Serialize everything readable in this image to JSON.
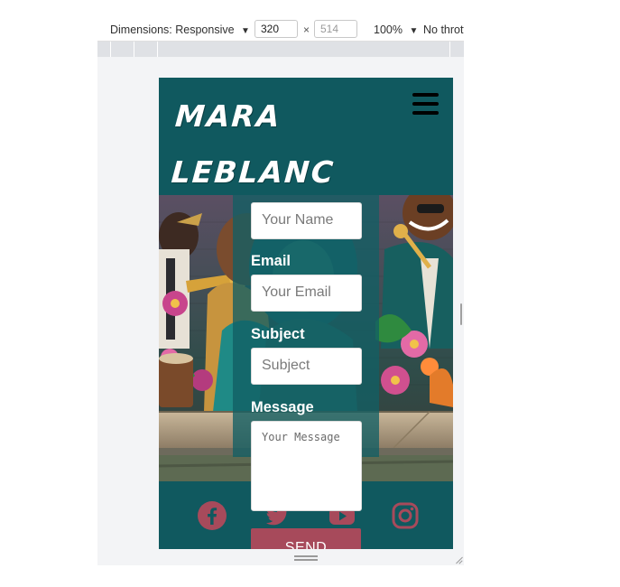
{
  "devtools": {
    "dimensions_label": "Dimensions: Responsive",
    "width_value": "320",
    "height_value": "514",
    "times_sign": "×",
    "zoom": "100%",
    "throttle": "No throttling",
    "caret": "▼"
  },
  "site": {
    "logo_line1": "MARA",
    "logo_line2": "LEBLANC",
    "menu_icon": "hamburger-menu-icon"
  },
  "form": {
    "name_placeholder": "Your Name",
    "email_label": "Email",
    "email_placeholder": "Your Email",
    "subject_label": "Subject",
    "subject_placeholder": "Subject",
    "message_label": "Message",
    "message_placeholder": "Your Message",
    "send_label": "SEND"
  },
  "footer": {
    "icons": [
      "facebook-icon",
      "twitter-icon",
      "youtube-icon",
      "instagram-icon"
    ],
    "icon_color": "#a74a5b"
  },
  "colors": {
    "brand_teal": "#10595f",
    "accent": "#a74a5b"
  }
}
